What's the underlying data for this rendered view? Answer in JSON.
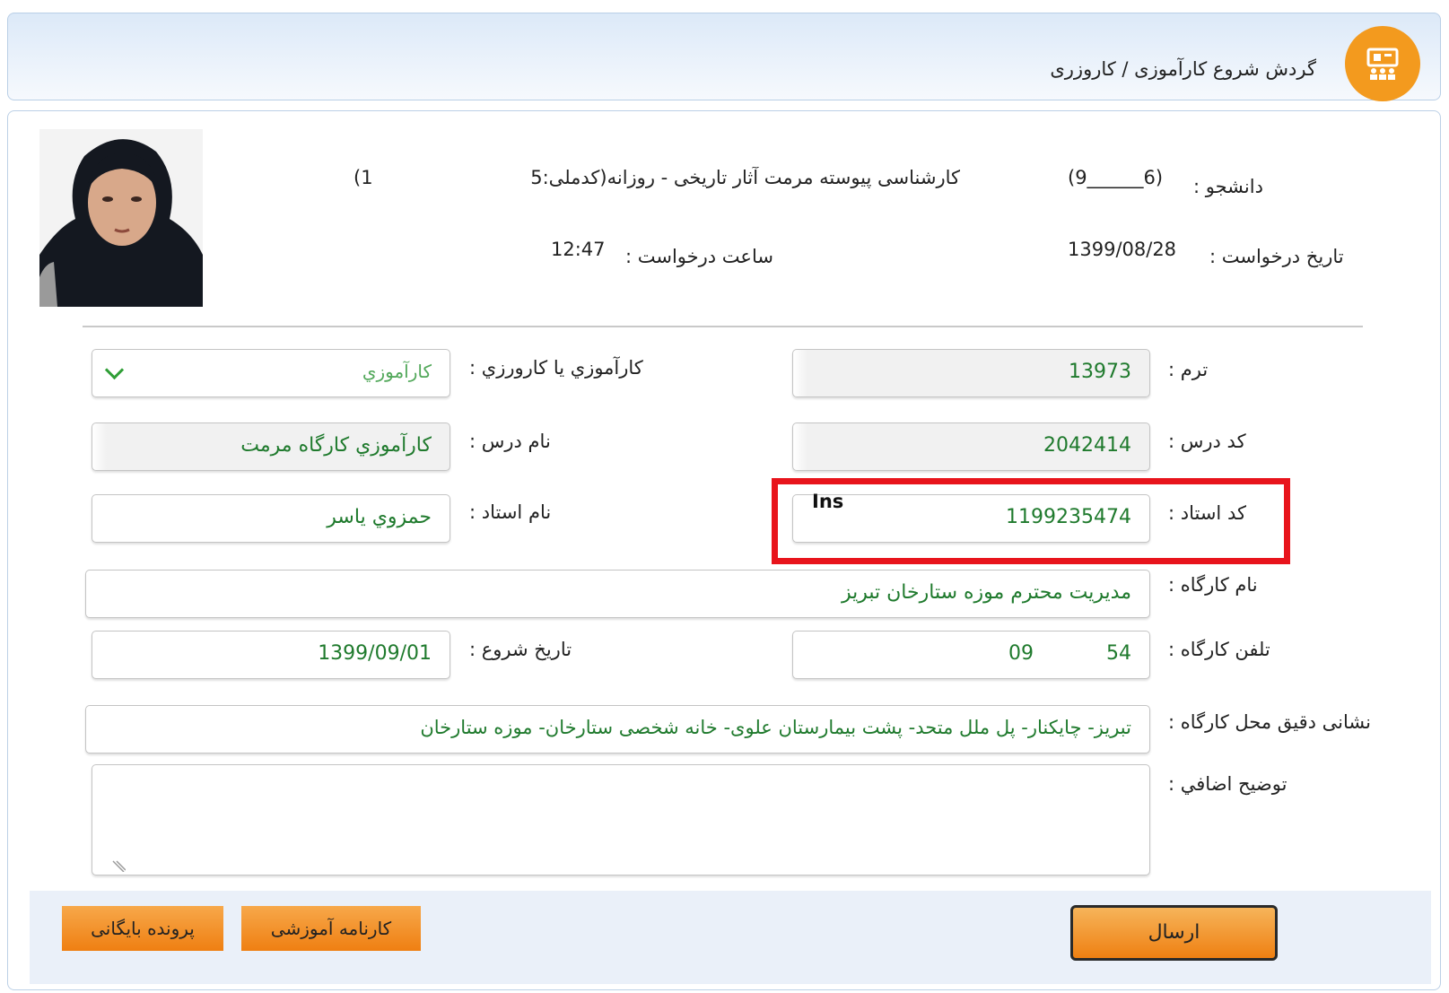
{
  "header": {
    "title": "گردش شروع کارآموزی / کاروزری",
    "icon": "presentation-board-icon",
    "icon_color": "#f39a1e"
  },
  "student": {
    "label": "دانشجو :",
    "id_text": "(9______6)",
    "program_text": "کارشناسی پیوسته مرمت آثار تاریخی - روزانه(کدملی:5",
    "code_tail": "(1"
  },
  "request": {
    "date_label": "تاریخ درخواست :",
    "date_value": "1399/08/28",
    "time_label": "ساعت درخواست :",
    "time_value": "12:47"
  },
  "form": {
    "term": {
      "label": "ترم :",
      "value": "13973"
    },
    "type": {
      "label": "کارآموزي يا کارورزي :",
      "value": "کارآموزي"
    },
    "course_code": {
      "label": "کد درس :",
      "value": "2042414"
    },
    "course_name": {
      "label": "نام درس :",
      "value": "کارآموزي کارگاه مرمت"
    },
    "instructor_code": {
      "label": "کد استاد :",
      "value": "1199235474",
      "overlay": "Ins"
    },
    "instructor_name": {
      "label": "نام استاد :",
      "value": "حمزوي ياسر"
    },
    "workshop_name": {
      "label": "نام کارگاه :",
      "value": "مدیریت محترم موزه ستارخان تبریز"
    },
    "workshop_phone": {
      "label": "تلفن کارگاه :",
      "value_start": "09",
      "value_end": "54"
    },
    "start_date": {
      "label": "تاریخ شروع :",
      "value": "1399/09/01"
    },
    "address": {
      "label": "نشانی دقیق محل کارگاه :",
      "value": "تبریز- چایکنار- پل ملل متحد- پشت بیمارستان علوی- خانه شخصی ستارخان- موزه ستارخان"
    },
    "notes": {
      "label": "توضیح اضافي :",
      "value": ""
    }
  },
  "buttons": {
    "send": "ارسال",
    "transcript": "کارنامه آموزشی",
    "archive": "پرونده بایگانی"
  },
  "colors": {
    "accent_orange": "#ef8012",
    "value_green": "#1f7a2d",
    "highlight_red": "#e8141c",
    "header_blue": "#dce9f8"
  }
}
